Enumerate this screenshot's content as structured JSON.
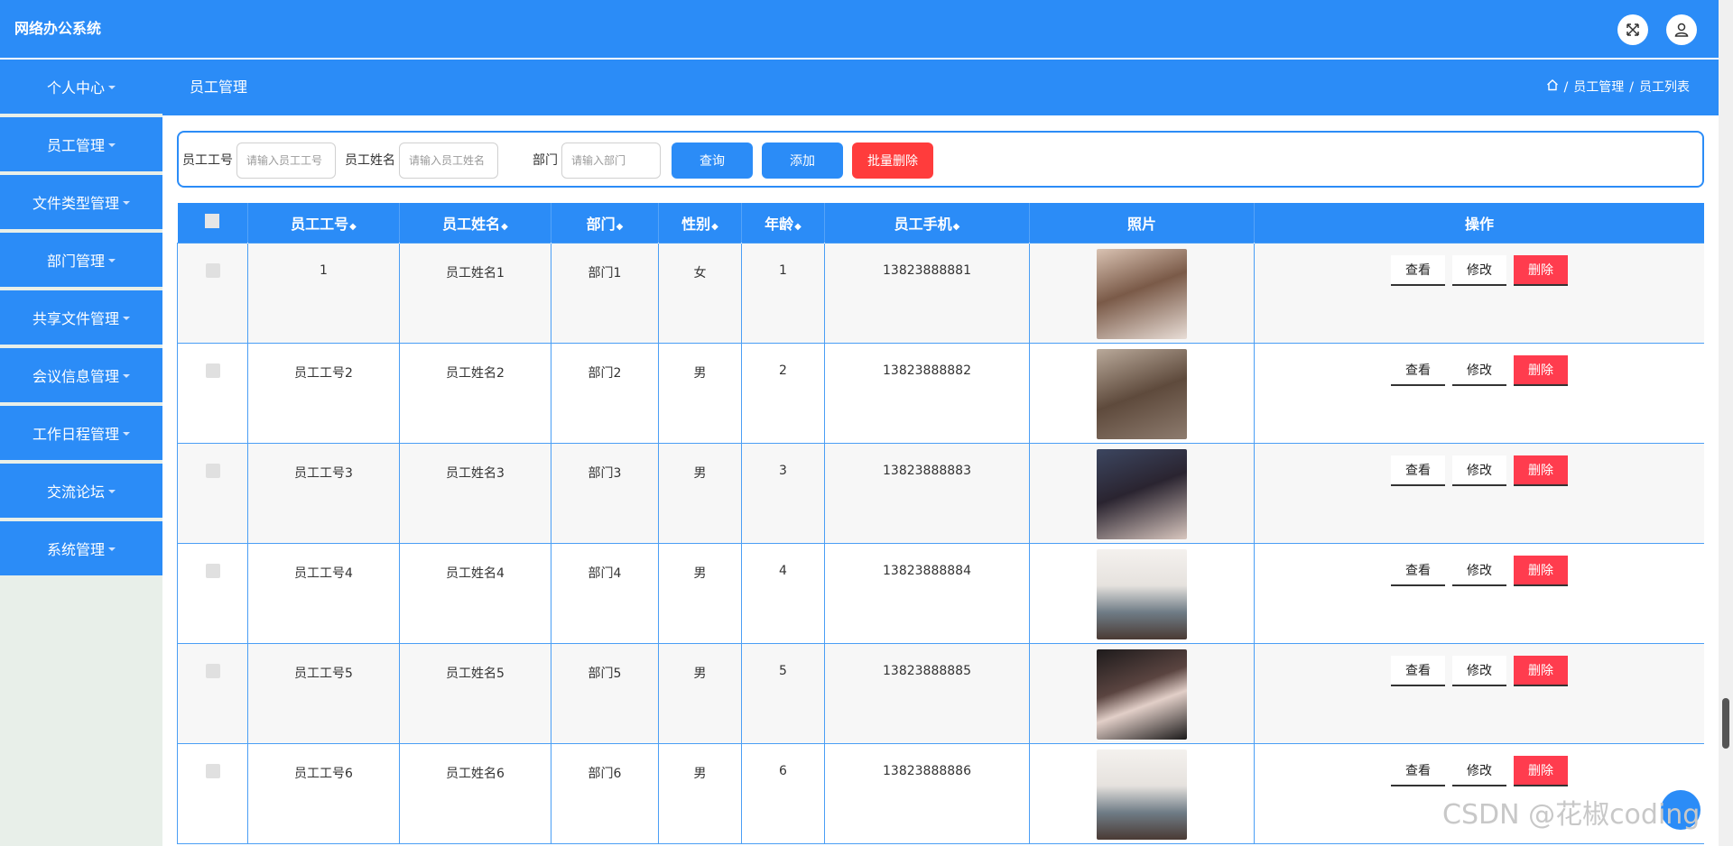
{
  "app": {
    "title": "网络办公系统"
  },
  "subheader": {
    "title": "员工管理",
    "breadcrumb": [
      "员工管理",
      "员工列表"
    ]
  },
  "sidebar": {
    "items": [
      {
        "label": "个人中心"
      },
      {
        "label": "员工管理"
      },
      {
        "label": "文件类型管理"
      },
      {
        "label": "部门管理"
      },
      {
        "label": "共享文件管理"
      },
      {
        "label": "会议信息管理"
      },
      {
        "label": "工作日程管理"
      },
      {
        "label": "交流论坛"
      },
      {
        "label": "系统管理"
      }
    ]
  },
  "search": {
    "emp_no_label": "员工工号",
    "emp_no_placeholder": "请输入员工工号",
    "emp_name_label": "员工姓名",
    "emp_name_placeholder": "请输入员工姓名",
    "dept_label": "部门",
    "dept_placeholder": "请输入部门",
    "query_label": "查询",
    "add_label": "添加",
    "batch_delete_label": "批量删除"
  },
  "table": {
    "headers": {
      "emp_no": "员工工号",
      "emp_name": "员工姓名",
      "dept": "部门",
      "gender": "性别",
      "age": "年龄",
      "phone": "员工手机",
      "photo": "照片",
      "actions": "操作"
    },
    "action_labels": {
      "view": "查看",
      "edit": "修改",
      "delete": "删除"
    },
    "rows": [
      {
        "emp_no": "1",
        "emp_name": "员工姓名1",
        "dept": "部门1",
        "gender": "女",
        "age": "1",
        "phone": "13823888881"
      },
      {
        "emp_no": "员工工号2",
        "emp_name": "员工姓名2",
        "dept": "部门2",
        "gender": "男",
        "age": "2",
        "phone": "13823888882"
      },
      {
        "emp_no": "员工工号3",
        "emp_name": "员工姓名3",
        "dept": "部门3",
        "gender": "男",
        "age": "3",
        "phone": "13823888883"
      },
      {
        "emp_no": "员工工号4",
        "emp_name": "员工姓名4",
        "dept": "部门4",
        "gender": "男",
        "age": "4",
        "phone": "13823888884"
      },
      {
        "emp_no": "员工工号5",
        "emp_name": "员工姓名5",
        "dept": "部门5",
        "gender": "男",
        "age": "5",
        "phone": "13823888885"
      },
      {
        "emp_no": "员工工号6",
        "emp_name": "员工姓名6",
        "dept": "部门6",
        "gender": "男",
        "age": "6",
        "phone": "13823888886"
      }
    ]
  },
  "watermark": "CSDN @花椒coding",
  "colors": {
    "primary": "#2b8cf7",
    "danger": "#ff3c4e",
    "sidebar_bg": "#e8efe9"
  },
  "icons": [
    "fullscreen-icon",
    "user-icon",
    "home-icon",
    "sort-icon"
  ]
}
